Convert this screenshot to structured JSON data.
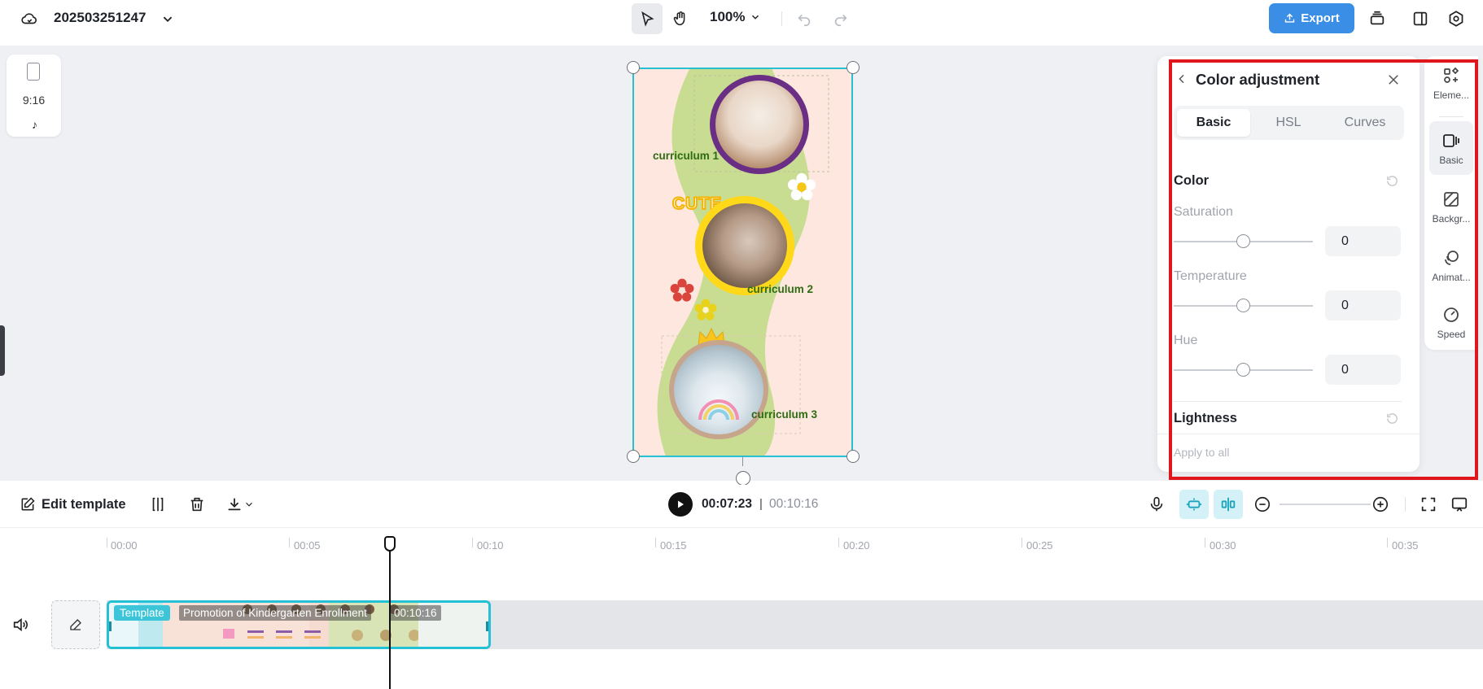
{
  "topbar": {
    "project_name": "202503251247",
    "zoom": "100%",
    "export_label": "Export"
  },
  "workspace": {
    "aspect_ratio": "9:16",
    "canvas_labels": {
      "curriculum_1": "curriculum 1",
      "curriculum_2": "curriculum 2",
      "curriculum_3": "curriculum 3",
      "cute_sticker": "CUTE"
    }
  },
  "color_panel": {
    "title": "Color adjustment",
    "tabs": [
      "Basic",
      "HSL",
      "Curves"
    ],
    "active_tab": "Basic",
    "color_section": "Color",
    "sliders": [
      {
        "label": "Saturation",
        "value": "0"
      },
      {
        "label": "Temperature",
        "value": "0"
      },
      {
        "label": "Hue",
        "value": "0"
      }
    ],
    "lightness_section": "Lightness",
    "apply_all": "Apply to all"
  },
  "rail": {
    "items": [
      {
        "label": "Eleme...",
        "icon": "elements-icon"
      },
      {
        "label": "Basic",
        "icon": "basic-icon"
      },
      {
        "label": "Backgr...",
        "icon": "background-icon"
      },
      {
        "label": "Animat...",
        "icon": "animation-icon"
      },
      {
        "label": "Speed",
        "icon": "speed-icon"
      }
    ],
    "active": "Basic"
  },
  "toolbar": {
    "edit_template": "Edit template",
    "current_time": "00:07:23",
    "separator": "|",
    "total_time": "00:10:16"
  },
  "timeline": {
    "ruler": [
      "00:00",
      "00:05",
      "00:10",
      "00:15",
      "00:20",
      "00:25",
      "00:30",
      "00:35"
    ],
    "clip": {
      "badge": "Template",
      "name": "Promotion of Kindergarten Enrollment",
      "duration": "00:10:16"
    }
  },
  "colors": {
    "accent": "#3a8ee6",
    "selection": "#27bfd2",
    "highlight": "#e0161d"
  }
}
